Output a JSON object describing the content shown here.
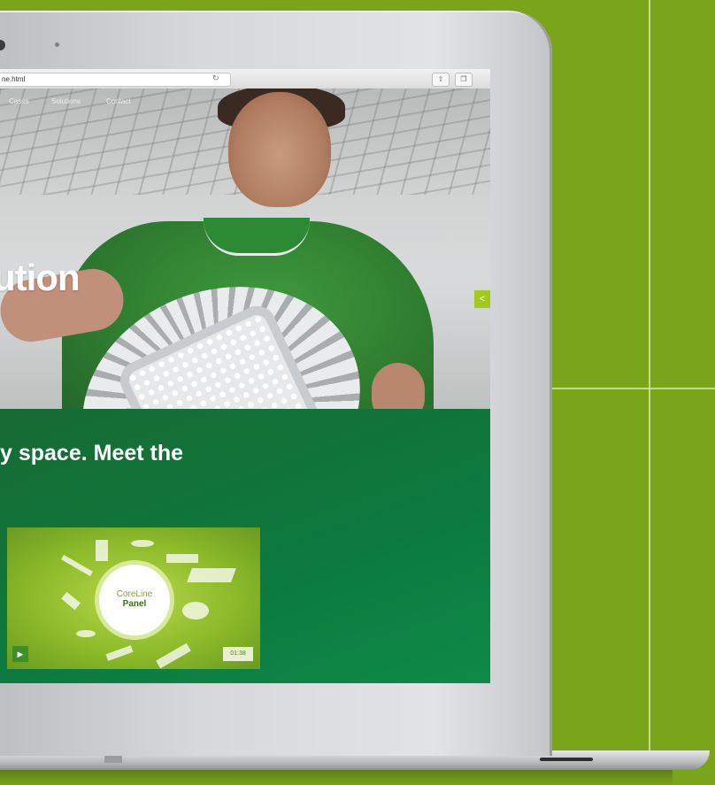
{
  "browser": {
    "url": "ne.html"
  },
  "nav": [
    "Cases",
    "Solutions",
    "Contact"
  ],
  "hero": {
    "title_fragment": "ution"
  },
  "content": {
    "tagline_fragment": "y space. Meet the"
  },
  "video": {
    "title_line1": "CoreLine",
    "title_line2": "Panel",
    "duration": "01:38"
  },
  "colors": {
    "background_green": "#7aa41a",
    "page_green": "#0c7a3f",
    "accent_lime": "#a6c71e"
  },
  "icons": [
    "camera-icon",
    "reload-icon",
    "share-icon",
    "tabs-icon",
    "play-icon"
  ]
}
